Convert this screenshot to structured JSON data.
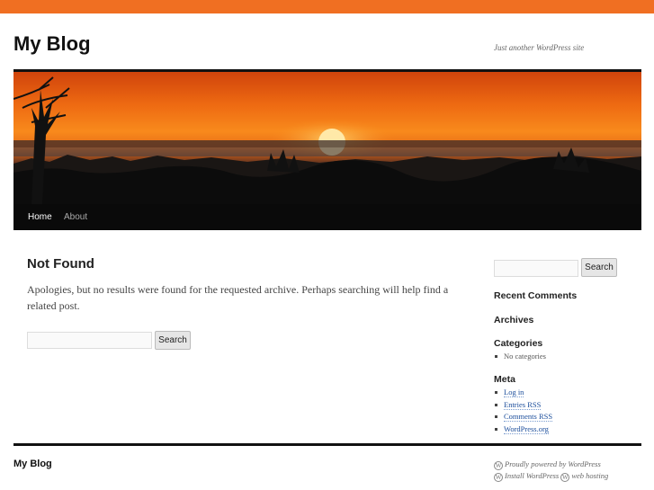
{
  "colors": {
    "top_bar": "#f06f22",
    "link": "#1b4d9b",
    "nav_bg": "#0a0a0a"
  },
  "header": {
    "title": "My Blog",
    "description": "Just another WordPress site"
  },
  "nav": {
    "items": [
      {
        "label": "Home",
        "active": true
      },
      {
        "label": "About",
        "active": false
      }
    ]
  },
  "main": {
    "title": "Not Found",
    "message": "Apologies, but no results were found for the requested archive. Perhaps searching will help find a related post.",
    "search": {
      "value": "",
      "button": "Search"
    }
  },
  "sidebar": {
    "search": {
      "value": "",
      "button": "Search"
    },
    "recent_comments": "Recent Comments",
    "archives": "Archives",
    "categories": {
      "title": "Categories",
      "empty": "No categories"
    },
    "meta": {
      "title": "Meta",
      "links": [
        "Log in",
        "Entries RSS",
        "Comments RSS",
        "WordPress.org"
      ]
    }
  },
  "footer": {
    "title": "My Blog",
    "credit_1": "Proudly powered by WordPress",
    "credit_2a": "Install WordPress",
    "credit_2b": "web hosting",
    "wp_icon": "wordpress-logo-icon"
  }
}
